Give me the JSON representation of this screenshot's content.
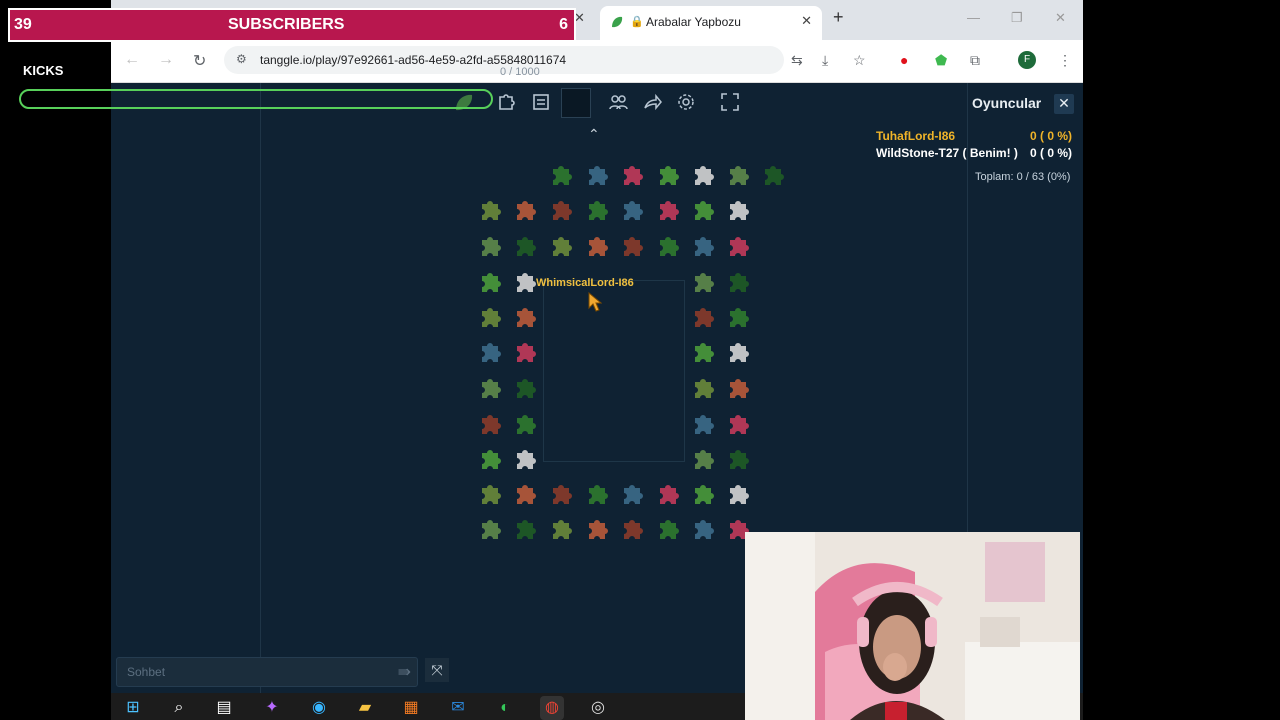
{
  "browser": {
    "active_tab_title": "Arabalar Yapbozu",
    "url": "tanggle.io/play/97e92661-ad56-4e59-a2fd-a55848011674"
  },
  "game": {
    "counter": "0 / 1000",
    "player_tag": "WhimsicalLord-I86",
    "chat_placeholder": "Sohbet",
    "players_panel": {
      "title": "Oyuncular",
      "players": [
        {
          "name": "TuhafLord-I86",
          "score": "0 ( 0 %)",
          "color": "#f0b429"
        },
        {
          "name": "WildStone-T27 ( Benim! )",
          "score": "0 ( 0 %)",
          "color": "#ffffff"
        }
      ],
      "total": "Toplam: 0 / 63 (0%)"
    }
  },
  "overlay": {
    "subs_count": "39",
    "subs_label": "SUBSCRIBERS",
    "subs_right": "6",
    "kicks_label": "KICKS"
  },
  "colors": {
    "game_bg": "#0f2233",
    "subs_bg": "#b8174e",
    "kicks_bar": "#58d05a"
  }
}
